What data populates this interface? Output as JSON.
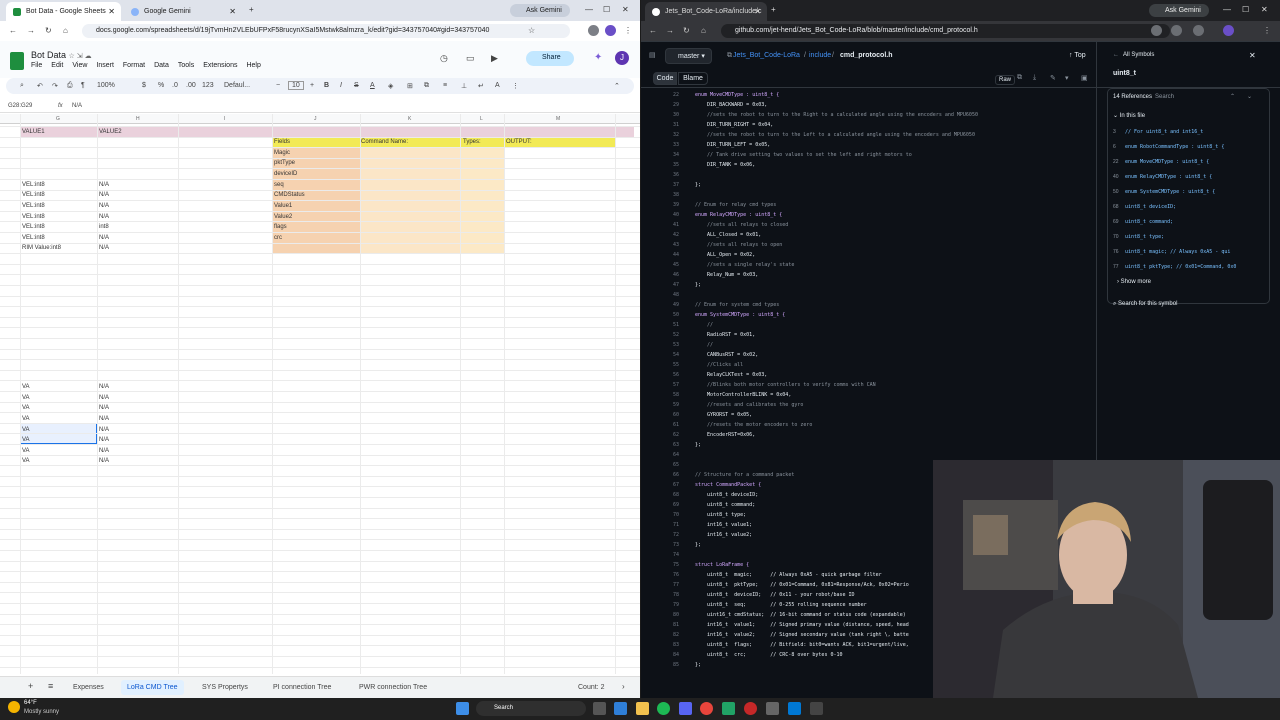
{
  "left_window": {
    "tabs": [
      {
        "label": "Bot Data - Google Sheets",
        "active": true
      },
      {
        "label": "Google Gemini",
        "active": false
      }
    ],
    "gemini_button": "Ask Gemini",
    "url": "docs.google.com/spreadsheets/d/19jTvmHn2VLEbUFPxF58rucynXSaI5Mstwk8almzra_k/edit?gid=343757040#gid=343757040",
    "sheet_title": "Bot Data",
    "menu": [
      "File",
      "Edit",
      "View",
      "Insert",
      "Format",
      "Data",
      "Tools",
      "Extensions",
      "Help"
    ],
    "share_label": "Share",
    "avatar_letter": "J",
    "toolbar": {
      "zoom": "100%",
      "currency": "$",
      "percent": "%",
      "font": "Defaul...",
      "size": "10"
    },
    "name_box": "G28:G29",
    "formula": "N/A",
    "col_headers": [
      "G",
      "H",
      "I",
      "J",
      "K",
      "L",
      "M"
    ],
    "header_row": {
      "g": "VALUE1",
      "h": "VALUE2"
    },
    "table_headers": {
      "fields": "Fields",
      "command": "Command Name:",
      "types": "Types:",
      "output": "OUTPUT:"
    },
    "fields": [
      "Magic",
      "pktType",
      "deviceID",
      "seq",
      "CMDStatus",
      "Value1",
      "Value2",
      "flags",
      "crc"
    ],
    "g_values": [
      "",
      "",
      "",
      "",
      "VEL:int8",
      "VEL:int8",
      "VEL:int8",
      "VEL:int8",
      "VEL:int8",
      "VEL:int8",
      "RIM Value:int8"
    ],
    "h_values": [
      "",
      "",
      "",
      "",
      "N/A",
      "N/A",
      "N/A",
      "N/A",
      "int8",
      "N/A",
      "N/A"
    ],
    "lower_g": [
      "VA",
      "VA",
      "VA",
      "VA",
      "VA",
      "VA",
      "VA",
      "VA"
    ],
    "lower_h": [
      "N/A",
      "N/A",
      "N/A",
      "N/A",
      "N/A",
      "N/A",
      "N/A",
      "N/A"
    ],
    "sheet_tabs": [
      "Expenses",
      "LoRa CMD Tree",
      "SYS Propertys",
      "PI connection Tree",
      "PWR connection Tree"
    ],
    "count": "Count: 2"
  },
  "right_window": {
    "tab": "Jets_Bot_Code-LoRa/include/c",
    "gemini_button": "Ask Gemini",
    "url": "github.com/jet-hend/Jets_Bot_Code-LoRa/blob/master/include/cmd_protocol.h",
    "branch": "master",
    "breadcrumb": [
      "Jets_Bot_Code-LoRa",
      "include",
      "cmd_protocol.h"
    ],
    "top_label": "Top",
    "code_tabs": [
      "Code",
      "Blame"
    ],
    "raw_label": "Raw",
    "symbols": {
      "title": "All Symbols",
      "search": "uint8_t",
      "refs": "14 References",
      "search_ref": "Search",
      "in_file": "In this file",
      "items": [
        {
          "n": "3",
          "t": "// For uint8_t and int16_t"
        },
        {
          "n": "6",
          "t": "enum RobotCommandType : uint8_t {"
        },
        {
          "n": "22",
          "t": "enum MoveCMDType : uint8_t {"
        },
        {
          "n": "40",
          "t": "enum RelayCMDType : uint8_t {"
        },
        {
          "n": "50",
          "t": "enum SystemCMDType : uint8_t {"
        },
        {
          "n": "68",
          "t": "uint8_t deviceID;"
        },
        {
          "n": "69",
          "t": "uint8_t command;"
        },
        {
          "n": "70",
          "t": "uint8_t type;"
        },
        {
          "n": "76",
          "t": "uint8_t  magic;      // Always 0xA5 - qui"
        },
        {
          "n": "77",
          "t": "uint8_t  pktType;    // 0x01=Command, 0x0"
        }
      ],
      "show_more": "Show more",
      "search_symbol": "Search for this symbol"
    },
    "code_lines": [
      {
        "n": "22",
        "t": "enum MoveCMDType : uint8_t {"
      },
      {
        "n": "29",
        "t": "    DIR_BACKWARD = 0x03,"
      },
      {
        "n": "30",
        "t": "    //sets the robot to turn to the Right to a calculated angle using the encoders and MPU6050"
      },
      {
        "n": "31",
        "t": "    DIR_TURN_RIGHT = 0x04,"
      },
      {
        "n": "32",
        "t": "    //sets the robot to turn to the Left to a calculated angle using the encoders and MPU6050"
      },
      {
        "n": "33",
        "t": "    DIR_TURN_LEFT = 0x05,"
      },
      {
        "n": "34",
        "t": "    // Tank drive setting two values to set the left and right motors to"
      },
      {
        "n": "35",
        "t": "    DIR_TANK = 0x06,"
      },
      {
        "n": "36",
        "t": ""
      },
      {
        "n": "37",
        "t": "};"
      },
      {
        "n": "38",
        "t": ""
      },
      {
        "n": "39",
        "t": "// Enum for relay cmd types"
      },
      {
        "n": "40",
        "t": "enum RelayCMDType : uint8_t {"
      },
      {
        "n": "41",
        "t": "    //sets all relays to closed"
      },
      {
        "n": "42",
        "t": "    ALL_Closed = 0x01,"
      },
      {
        "n": "43",
        "t": "    //sets all relays to open"
      },
      {
        "n": "44",
        "t": "    ALL_Open = 0x02,"
      },
      {
        "n": "45",
        "t": "    //sets a single relay's state"
      },
      {
        "n": "46",
        "t": "    Relay_Num = 0x03,"
      },
      {
        "n": "47",
        "t": "};"
      },
      {
        "n": "48",
        "t": ""
      },
      {
        "n": "49",
        "t": "// Enum for system cmd types"
      },
      {
        "n": "50",
        "t": "enum SystemCMDType : uint8_t {"
      },
      {
        "n": "51",
        "t": "    //"
      },
      {
        "n": "52",
        "t": "    RadioRST = 0x01,"
      },
      {
        "n": "53",
        "t": "    //"
      },
      {
        "n": "54",
        "t": "    CANBusRST = 0x02,"
      },
      {
        "n": "55",
        "t": "    //Clicks all"
      },
      {
        "n": "56",
        "t": "    RelayCLKTest = 0x03,"
      },
      {
        "n": "57",
        "t": "    //Blinks both motor controllers to verify comms with CAN"
      },
      {
        "n": "58",
        "t": "    MotorControllerBLINK = 0x04,"
      },
      {
        "n": "59",
        "t": "    //resets and calibrates the gyro"
      },
      {
        "n": "60",
        "t": "    GYRORST = 0x05,"
      },
      {
        "n": "61",
        "t": "    //resets the motor encoders to zero"
      },
      {
        "n": "62",
        "t": "    EncoderRST=0x06,"
      },
      {
        "n": "63",
        "t": "};"
      },
      {
        "n": "64",
        "t": ""
      },
      {
        "n": "65",
        "t": ""
      },
      {
        "n": "66",
        "t": "// Structure for a command packet"
      },
      {
        "n": "67",
        "t": "struct CommandPacket {"
      },
      {
        "n": "68",
        "t": "    uint8_t deviceID;"
      },
      {
        "n": "69",
        "t": "    uint8_t command;"
      },
      {
        "n": "70",
        "t": "    uint8_t type;"
      },
      {
        "n": "71",
        "t": "    int16_t value1;"
      },
      {
        "n": "72",
        "t": "    int16_t value2;"
      },
      {
        "n": "73",
        "t": "};"
      },
      {
        "n": "74",
        "t": ""
      },
      {
        "n": "75",
        "t": "struct LoRaFrame {"
      },
      {
        "n": "76",
        "t": "    uint8_t  magic;      // Always 0xA5 - quick garbage filter"
      },
      {
        "n": "77",
        "t": "    uint8_t  pktType;    // 0x01=Command, 0x81=Response/Ack, 0x02=Perio"
      },
      {
        "n": "78",
        "t": "    uint8_t  deviceID;   // 0x11 - your robot/base ID"
      },
      {
        "n": "79",
        "t": "    uint8_t  seq;        // 0-255 rolling sequence number"
      },
      {
        "n": "80",
        "t": "    uint16_t cmdStatus;  // 16-bit command or status code (expandable)"
      },
      {
        "n": "81",
        "t": "    int16_t  value1;     // Signed primary value (distance, speed, head"
      },
      {
        "n": "82",
        "t": "    int16_t  value2;     // Signed secondary value (tank right \\, batte"
      },
      {
        "n": "83",
        "t": "    uint8_t  flags;      // Bitfield: bit0=wants ACK, bit1=urgent/live,"
      },
      {
        "n": "84",
        "t": "    uint8_t  crc;        // CRC-8 over bytes 0-10"
      },
      {
        "n": "85",
        "t": "};"
      }
    ]
  },
  "taskbar": {
    "weather_temp": "64°F",
    "weather_desc": "Mostly sunny",
    "search": "Search"
  }
}
